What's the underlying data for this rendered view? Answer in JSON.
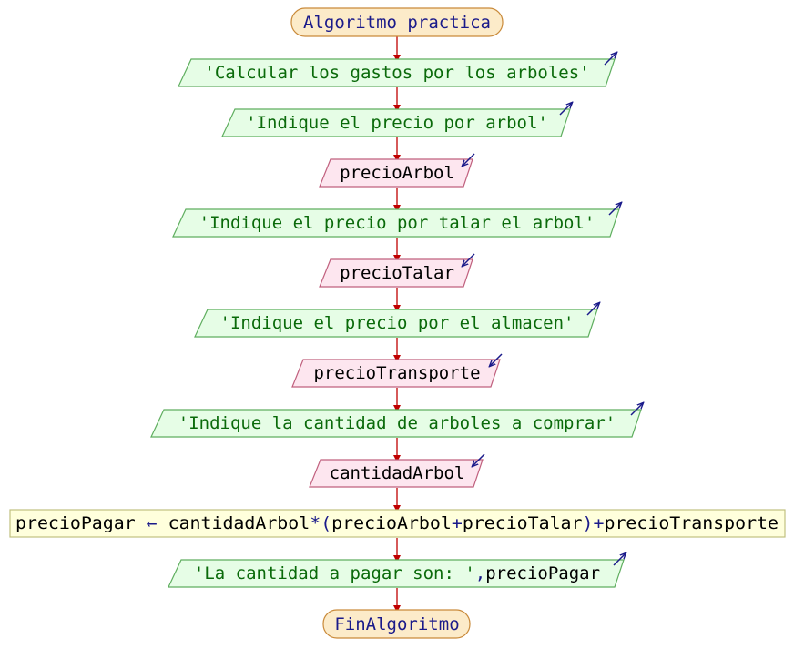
{
  "colors": {
    "terminal_fill": "#fcebc9",
    "terminal_stroke": "#c98a3a",
    "output_fill": "#e6fde6",
    "output_stroke": "#5fae5f",
    "input_fill": "#fde6ef",
    "input_stroke": "#c0607e",
    "process_fill": "#ffffdc",
    "process_stroke": "#c0c080",
    "arrow": "#c00000",
    "io_indicator": "#1a1a8a",
    "keyword_text": "#1a1a8a",
    "string_text": "#0a6a0a",
    "variable_text": "#000000"
  },
  "flow": {
    "title": "Algoritmo practica",
    "end": "FinAlgoritmo",
    "output_1": "'Calcular los gastos por los arboles'",
    "output_2": "'Indique el precio por arbol'",
    "input_1": "precioArbol",
    "output_3": "'Indique el precio por talar el arbol'",
    "input_2": "precioTalar",
    "output_4": "'Indique el precio por el almacen'",
    "input_3": "precioTransporte",
    "output_5": "'Indique la cantidad de arboles a comprar'",
    "input_4": "cantidadArbol",
    "assignment": {
      "target": "precioPagar",
      "arrow": "←",
      "expr_part1": "cantidadArbol",
      "op_mult": "*",
      "paren_open": "(",
      "expr_part2": "precioArbol",
      "op_plus1": "+",
      "expr_part3": "precioTalar",
      "paren_close": ")",
      "op_plus2": "+",
      "expr_part4": "precioTransporte"
    },
    "final_output": {
      "string_part": "'La cantidad a pagar son: '",
      "separator": ",",
      "variable_part": "precioPagar"
    }
  }
}
